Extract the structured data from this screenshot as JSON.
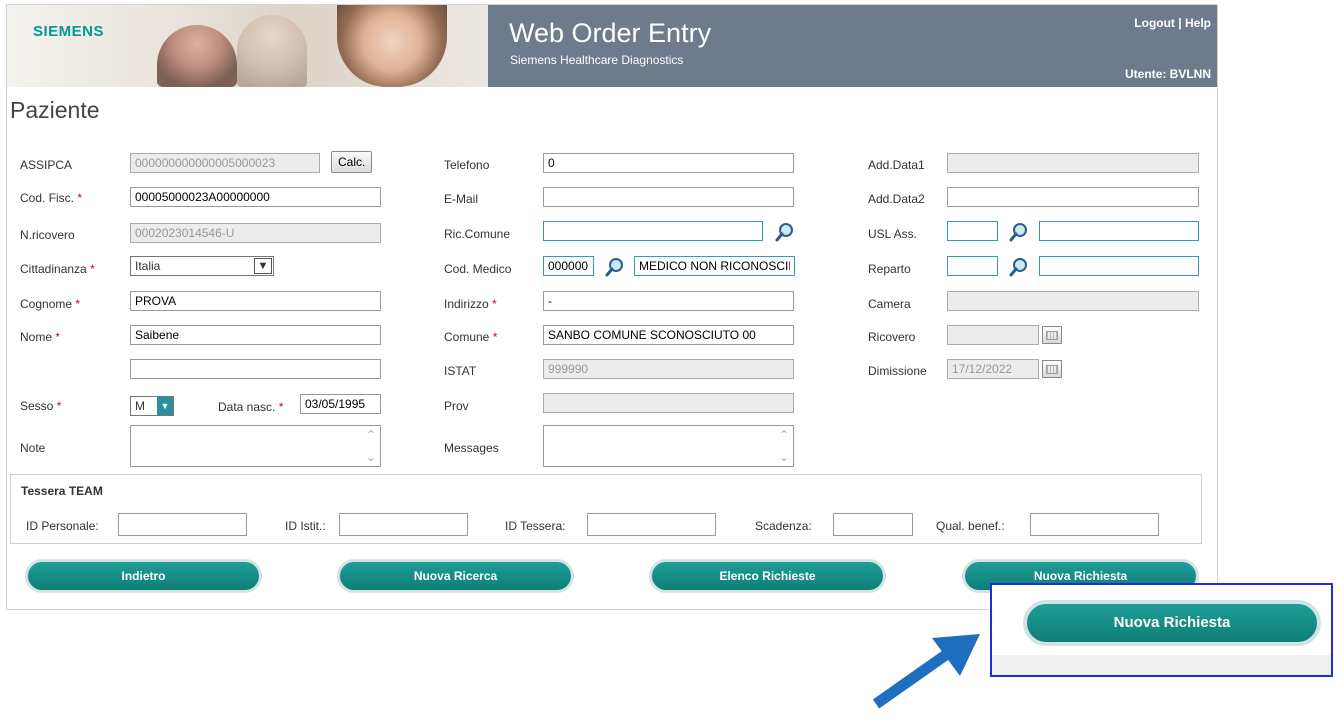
{
  "header": {
    "logo": "SIEMENS",
    "app_title": "Web Order Entry",
    "app_subtitle": "Siemens Healthcare Diagnostics",
    "logout": "Logout",
    "separator": "|",
    "help": "Help",
    "user_label": "Utente: BVLNN"
  },
  "page_title": "Paziente",
  "col1": {
    "assipca_label": "ASSIPCA",
    "assipca_value": "000000000000005000023",
    "calc_button": "Calc.",
    "codfisc_label": "Cod. Fisc.",
    "codfisc_value": "00005000023A00000000",
    "nricovero_label": "N.ricovero",
    "nricovero_value": "0002023014546-U",
    "cittadinanza_label": "Cittadinanza",
    "cittadinanza_value": "Italia",
    "cognome_label": "Cognome",
    "cognome_value": "PROVA",
    "nome_label": "Nome",
    "nome_value": "Saibene",
    "extra_value": "",
    "sesso_label": "Sesso",
    "sesso_value": "M",
    "datanasc_label": "Data nasc.",
    "datanasc_value": "03/05/1995",
    "note_label": "Note"
  },
  "col2": {
    "telefono_label": "Telefono",
    "telefono_value": "0",
    "email_label": "E-Mail",
    "email_value": "",
    "riccomune_label": "Ric.Comune",
    "riccomune_value": "",
    "codmedico_label": "Cod. Medico",
    "codmedico_value": "000000",
    "medico_name": "MEDICO NON RICONOSCIB",
    "indirizzo_label": "Indirizzo",
    "indirizzo_value": "-",
    "comune_label": "Comune",
    "comune_value": "SANBO COMUNE SCONOSCIUTO 00",
    "istat_label": "ISTAT",
    "istat_value": "999990",
    "prov_label": "Prov",
    "prov_value": "",
    "messages_label": "Messages"
  },
  "col3": {
    "adddata1_label": "Add.Data1",
    "adddata2_label": "Add.Data2",
    "uslass_label": "USL Ass.",
    "reparto_label": "Reparto",
    "camera_label": "Camera",
    "ricovero_label": "Ricovero",
    "dimissione_label": "Dimissione",
    "dimissione_value": "17/12/2022"
  },
  "tessera": {
    "title": "Tessera TEAM",
    "id_personale": "ID Personale:",
    "id_istit": "ID Istit.:",
    "id_tessera": "ID Tessera:",
    "scadenza": "Scadenza:",
    "qual_benef": "Qual. benef.:"
  },
  "actions": {
    "indietro": "Indietro",
    "nuova_ricerca": "Nuova Ricerca",
    "elenco_richieste": "Elenco Richieste",
    "nuova_richiesta": "Nuova Richiesta"
  },
  "required_mark": "*",
  "colors": {
    "accent": "#0f7d77",
    "titlebar": "#6d7b8d",
    "logo": "#009999",
    "highlight_box": "#1c2fd8",
    "arrow": "#1f6fc0"
  },
  "icons": [
    "magnifier-icon",
    "calendar-icon",
    "chevron-down-icon",
    "scroll-up-icon",
    "scroll-down-icon",
    "arrow-pointer-icon"
  ]
}
